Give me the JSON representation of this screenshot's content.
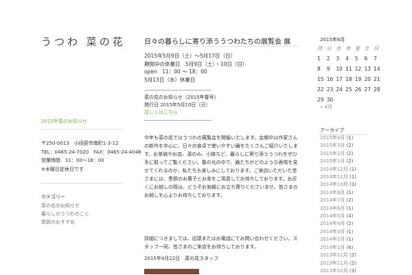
{
  "site": {
    "logo": "うつわ 菜の花"
  },
  "left": {
    "feature_link": "2015年春のお知らせ",
    "contact": {
      "address": "〒250-0013　小田原市南町1-3-12",
      "tel": "TEL：0465-24-7020　FAX：0465-24-4046",
      "hours": "営業時間　11：00～18：00",
      "closed": "※水曜日定休日です"
    },
    "menu_heading": "カテゴリー",
    "menu": [
      "菜の花のお知らせ",
      "暮らしのうつわのこと",
      "季節のおすすめ"
    ]
  },
  "post": {
    "title": "日々の暮らしに寄り添ううつわたちの展覧会 展",
    "meta": [
      "2015年5月9日（土）～5月17日（日）",
      "期間中の休業日　5月9日（土）・10日（日）",
      "open　11：00 ～ 18：00",
      "5月13日（水）休業日"
    ],
    "news_rule": "――――――――――――――",
    "news_line1": "菜の花のお知らせ（2015年春号）",
    "news_line2": "発行日 2015年5月10日（日）",
    "news_link": "詳しくはこちら",
    "paragraph1": "今年も菜の花ではうつわの展覧会を開催いたします。会期中は作家さんの新作を中心に、日々の食卓で使いやすい器をたくさんご紹介いたします。お茶碗やお皿、湯のみ、小鉢など、暮らしに寄り添ううつわをぜひ手に取ってご覧ください。春の光の中で、器たちがどのような表情を見せてくれるのか、私たちも楽しみにしております。ご来店いただいた皆さまには、季節のお菓子とお茶をご用意してお待ちしております。お近くにお越しの際は、どうぞお気軽にお立ち寄りくださいませ。皆さまのお越しを心よりお待ちしております。",
    "paragraph2": "詳細につきましては、店頭またはお電話にてお問い合わせください。スタッフ一同、皆さまのご来店をお待ちしております。",
    "date_line": "2015年4月22日　菜の花スタッフ"
  },
  "calendar": {
    "caption": "2015年6月",
    "weekdays": [
      "月",
      "火",
      "水",
      "木",
      "金",
      "土",
      "日"
    ],
    "weeks": [
      [
        "1",
        "2",
        "3",
        "4",
        "5",
        "6",
        "7"
      ],
      [
        "8",
        "9",
        "10",
        "11",
        "12",
        "13",
        "14"
      ],
      [
        "15",
        "16",
        "17",
        "18",
        "19",
        "20",
        "21"
      ],
      [
        "22",
        "23",
        "24",
        "25",
        "26",
        "27",
        "28"
      ],
      [
        "29",
        "30",
        "",
        "",
        "",
        "",
        ""
      ]
    ],
    "prev": "« 4月"
  },
  "archives": {
    "heading": "アーカイブ",
    "items": [
      {
        "label": "2015年4月",
        "count": "(1)"
      },
      {
        "label": "2015年3月",
        "count": "(2)"
      },
      {
        "label": "2015年2月",
        "count": "(2)"
      },
      {
        "label": "2015年1月",
        "count": "(2)"
      },
      {
        "label": "2014年12月",
        "count": "(1)"
      },
      {
        "label": "2014年11月",
        "count": "(1)"
      },
      {
        "label": "2014年10月",
        "count": "(3)"
      },
      {
        "label": "2014年8月",
        "count": "(1)"
      },
      {
        "label": "2014年7月",
        "count": "(2)"
      },
      {
        "label": "2014年6月",
        "count": "(1)"
      },
      {
        "label": "2014年5月",
        "count": "(4)"
      },
      {
        "label": "2014年4月",
        "count": "(2)"
      },
      {
        "label": "2014年3月",
        "count": "(1)"
      },
      {
        "label": "2014年2月",
        "count": "(1)"
      },
      {
        "label": "2014年1月",
        "count": "(6)"
      },
      {
        "label": "2013年12月",
        "count": "(2)"
      },
      {
        "label": "2013年11月",
        "count": "(2)"
      },
      {
        "label": "2013年10月",
        "count": "(3)"
      }
    ]
  }
}
